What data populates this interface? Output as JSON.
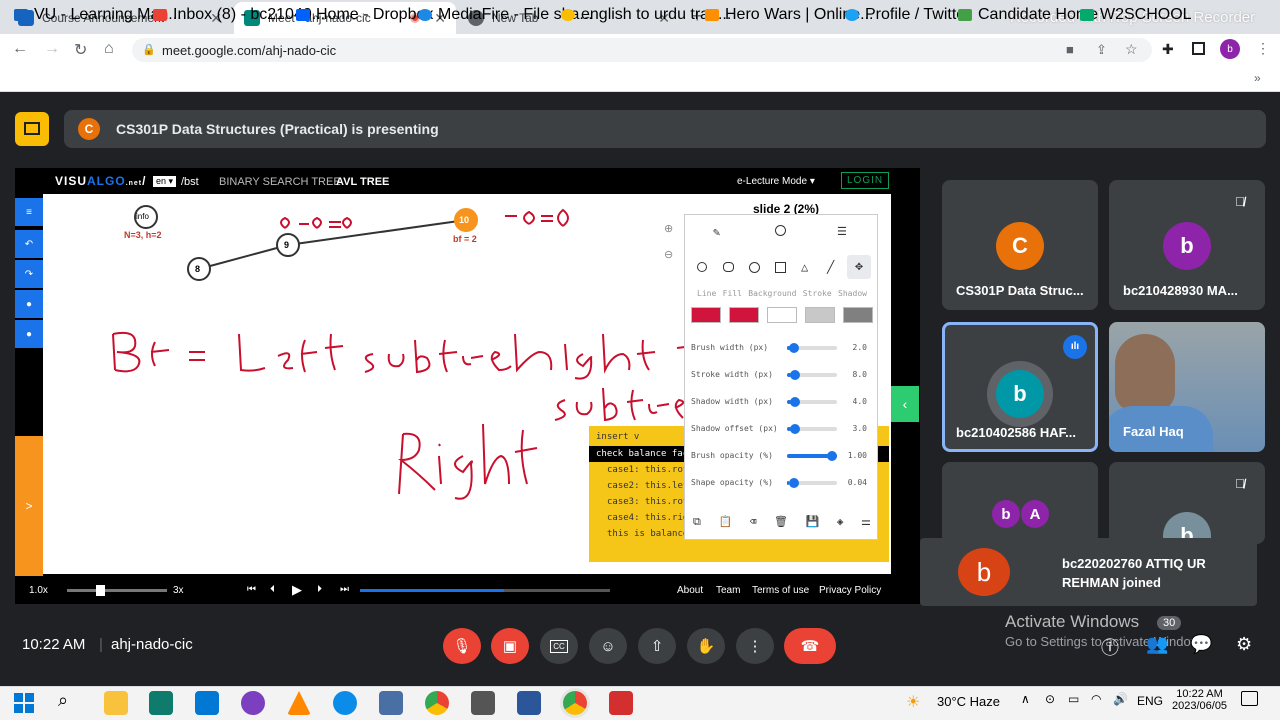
{
  "browser": {
    "tabs": [
      {
        "title": "Course Announcement",
        "active": false
      },
      {
        "title": "Meet - ahj-nado-cic",
        "active": true
      },
      {
        "title": "New Tab",
        "active": false
      }
    ],
    "url": "meet.google.com/ahj-nado-cic",
    "recorder_watermark": "Recorded with iTop Screen Recorder",
    "bookmarks": [
      "VU - Learning Man...",
      "Inbox (8) - bc21040...",
      "Home - Dropbox",
      "MediaFire - File sha...",
      "english to urdu tran...",
      "Hero Wars | Online...",
      "Profile / Twitter",
      "Candidate Home",
      "W2SCHOOL"
    ]
  },
  "meet": {
    "banner": "CS301P Data Structures (Practical) is presenting",
    "banner_avatar": "C",
    "meeting_code": "ahj-nado-cic",
    "time": "10:22 AM",
    "participants": [
      {
        "initial": "C",
        "name": "CS301P Data Struc...",
        "color": "#e8710a"
      },
      {
        "initial": "b",
        "name": "bc210428930 MA...",
        "color": "#8e24aa"
      },
      {
        "initial": "b",
        "name": "bc210402586 HAF...",
        "color": "#0097a7"
      },
      {
        "initial": "",
        "name": "Fazal Haq",
        "color": "#5f7f9f"
      },
      {
        "initial": "b",
        "name": "",
        "color": "#8e24aa"
      },
      {
        "initial": "A",
        "name": "",
        "color": "#8e24aa"
      },
      {
        "initial": "b",
        "name": "",
        "color": "#78909c"
      }
    ],
    "toast": {
      "initial": "b",
      "text": "bc220202760 ATTIQ UR REHMAN joined"
    },
    "activate": {
      "title": "Activate Windows",
      "badge": "30",
      "sub": "Go to Settings to activate Windows."
    }
  },
  "visualgo": {
    "logo_a": "VISU",
    "logo_b": "ALGO",
    "logo_c": ".net",
    "lang": "en",
    "path": "/bst",
    "nav": [
      "BINARY SEARCH TREE",
      "AVL TREE"
    ],
    "mode": "e-Lecture Mode",
    "login": "LOGIN",
    "slide": "slide 2 (2%)",
    "info": "info",
    "stats": "N=3, h=2",
    "nodes": [
      "8",
      "9",
      "10"
    ],
    "bf": "bf = 2",
    "code": [
      "insert v",
      "check balance factor",
      "case1: this.rotateRight",
      "case2: this.left.rotateLeft",
      "case3: this.rotateLeft",
      "case4: this.right.rotateRight",
      "this is balanced"
    ],
    "speed_min": "1.0x",
    "speed_max": "3x",
    "footer": [
      "About",
      "Team",
      "Terms of use",
      "Privacy Policy"
    ],
    "tool_tabs": [
      "Line",
      "Fill",
      "Background",
      "Stroke",
      "Shadow"
    ],
    "colors": [
      "#d0143c",
      "#d0143c",
      "#ffffff",
      "#c8c8c8",
      "#808080"
    ],
    "sliders": [
      {
        "label": "Brush width (px)",
        "value": "2.0",
        "pos": 0.05
      },
      {
        "label": "Stroke width (px)",
        "value": "8.0",
        "pos": 0.08
      },
      {
        "label": "Shadow width (px)",
        "value": "4.0",
        "pos": 0.08
      },
      {
        "label": "Shadow offset (px)",
        "value": "3.0",
        "pos": 0.08
      },
      {
        "label": "Brush opacity (%)",
        "value": "1.00",
        "pos": 1.0
      },
      {
        "label": "Shape opacity (%)",
        "value": "0.04",
        "pos": 0.04
      }
    ],
    "handwriting": [
      "0-0=0",
      "-0=0",
      "Bf = Left subtree height -",
      "subtree",
      "Right"
    ]
  },
  "taskbar": {
    "weather": "30°C Haze",
    "lang": "ENG",
    "time": "10:22 AM",
    "date": "2023/06/05"
  }
}
